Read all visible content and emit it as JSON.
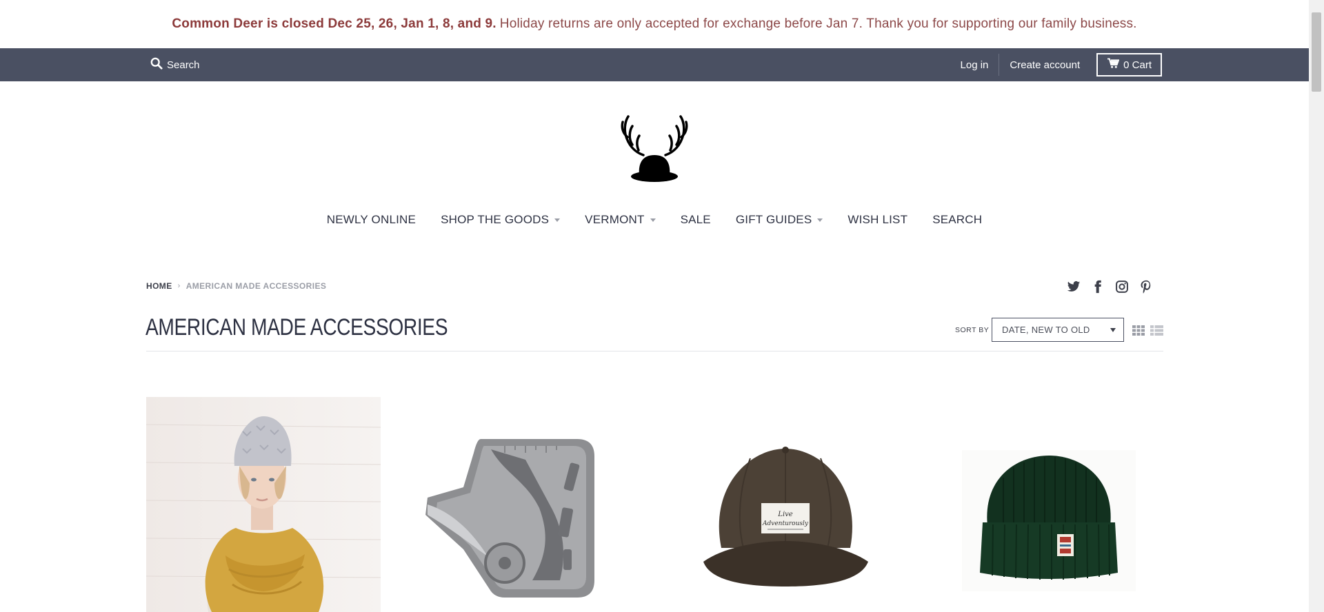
{
  "announcement": {
    "bold": "Common Deer is closed Dec 25, 26, Jan 1, 8, and 9.",
    "text": "Holiday returns are only accepted for exchange before Jan 7. Thank you for supporting our family business."
  },
  "topbar": {
    "search_label": "Search",
    "login_label": "Log in",
    "create_account_label": "Create account",
    "cart_label": "0 Cart",
    "background_color": "#4a5062"
  },
  "nav": {
    "items": [
      {
        "label": "NEWLY ONLINE",
        "dropdown": false
      },
      {
        "label": "SHOP THE GOODS",
        "dropdown": true
      },
      {
        "label": "VERMONT",
        "dropdown": true
      },
      {
        "label": "SALE",
        "dropdown": false
      },
      {
        "label": "GIFT GUIDES",
        "dropdown": true
      },
      {
        "label": "WISH LIST",
        "dropdown": false
      },
      {
        "label": "SEARCH",
        "dropdown": false
      }
    ]
  },
  "breadcrumb": {
    "home": "HOME",
    "separator": "›",
    "current": "AMERICAN MADE ACCESSORIES"
  },
  "social": [
    "twitter-icon",
    "facebook-icon",
    "instagram-icon",
    "pinterest-icon"
  ],
  "collection": {
    "title": "AMERICAN MADE ACCESSORIES",
    "sort_by_label": "SORT BY",
    "sort_value": "DATE, NEW TO OLD"
  },
  "products": [
    {
      "image": "woman-in-knit-beanie-and-mustard-scarf"
    },
    {
      "image": "wolf-multi-tool-card"
    },
    {
      "image": "brown-cap-live-adventurously"
    },
    {
      "image": "dark-green-knit-beanie"
    }
  ],
  "colors": {
    "announcement_text": "#8c3c3c",
    "accent": "#4a5062"
  }
}
